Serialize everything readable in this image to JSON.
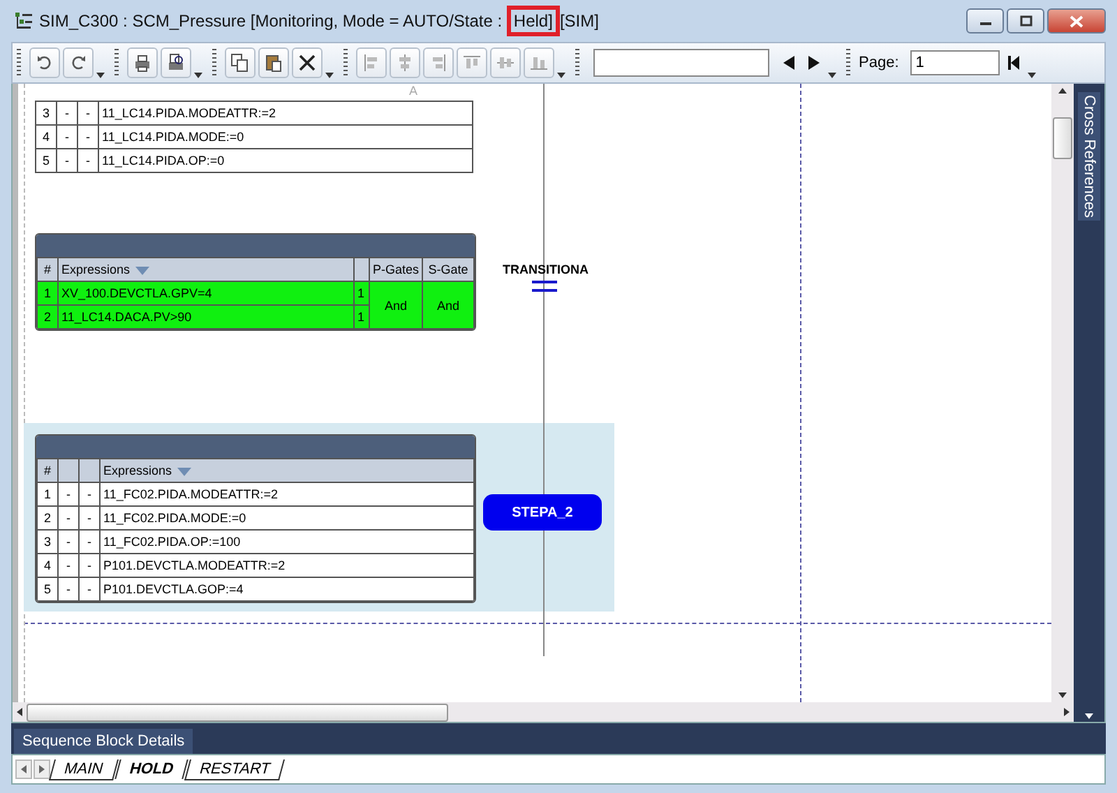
{
  "window": {
    "title_parts": [
      {
        "text": "SIM_C300 : SCM_Pressure [Monitoring, Mode  = AUTO/State : ",
        "highlighted": false
      },
      {
        "text": "Held]",
        "highlighted": true
      },
      {
        "text": "[SIM]",
        "highlighted": false
      }
    ]
  },
  "toolbar": {
    "page_label": "Page:",
    "page_value": "1"
  },
  "canvas": {
    "column_marker": "A",
    "top_table": {
      "rows": [
        {
          "num": "3",
          "col_2": "-",
          "col_3": "-",
          "expression": "11_LC14.PIDA.MODEATTR:=2"
        },
        {
          "num": "4",
          "col_2": "-",
          "col_3": "-",
          "expression": "11_LC14.PIDA.MODE:=0"
        },
        {
          "num": "5",
          "col_2": "-",
          "col_3": "-",
          "expression": "11_LC14.PIDA.OP:=0"
        }
      ]
    },
    "transition_table": {
      "columns": [
        "#",
        "Expressions",
        "P-Gates",
        "S-Gate"
      ],
      "p_gate": "And",
      "s_gate": "And",
      "active": true,
      "rows": [
        {
          "num": "1",
          "expression": "XV_100.DEVCTLA.GPV=4",
          "count": "1"
        },
        {
          "num": "2",
          "expression": "11_LC14.DACA.PV>90",
          "count": "1"
        }
      ]
    },
    "transition": {
      "label": "TRANSITIONA"
    },
    "step_table": {
      "columns": [
        "#",
        "Expressions"
      ],
      "rows": [
        {
          "num": "1",
          "col_2": "-",
          "col_3": "-",
          "expression": "11_FC02.PIDA.MODEATTR:=2"
        },
        {
          "num": "2",
          "col_2": "-",
          "col_3": "-",
          "expression": "11_FC02.PIDA.MODE:=0"
        },
        {
          "num": "3",
          "col_2": "-",
          "col_3": "-",
          "expression": "11_FC02.PIDA.OP:=100"
        },
        {
          "num": "4",
          "col_2": "-",
          "col_3": "-",
          "expression": "P101.DEVCTLA.MODEATTR:=2"
        },
        {
          "num": "5",
          "col_2": "-",
          "col_3": "-",
          "expression": "P101.DEVCTLA.GOP:=4"
        }
      ]
    },
    "step": {
      "label": "STEPA_2"
    }
  },
  "side_panel": {
    "label": "Cross References"
  },
  "details_panel": {
    "label": "Sequence Block Details"
  },
  "sheet_tabs": [
    {
      "label": "MAIN",
      "selected": false
    },
    {
      "label": "HOLD",
      "selected": true
    },
    {
      "label": "RESTART",
      "selected": false
    }
  ]
}
